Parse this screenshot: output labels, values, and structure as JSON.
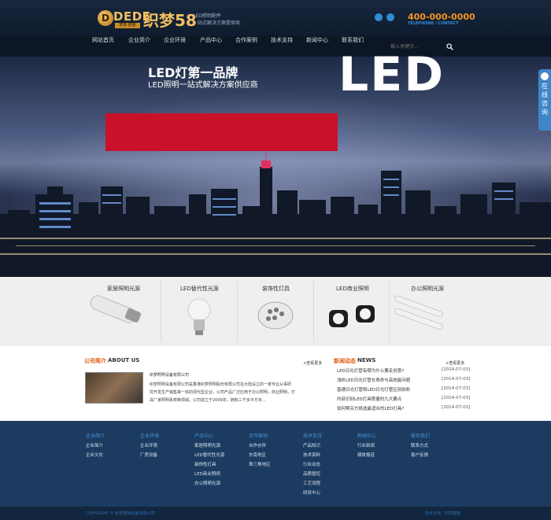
{
  "header": {
    "logo_mark": "D",
    "logo_brand": "DEDE",
    "logo_brand_sub": "梦想·技能",
    "logo_name": "织梦58",
    "slogan_line1": "LED照明配件",
    "slogan_line2": "一站式解决方案提供商",
    "phone": "400-000-0000",
    "phone_sub": "TELEPHONE / CONTACT"
  },
  "nav": {
    "items": [
      "网站首页",
      "企业简介",
      "企业环境",
      "产品中心",
      "合作案例",
      "技术支持",
      "新闻中心",
      "联系我们"
    ],
    "search_placeholder": "输入关键字..."
  },
  "banner": {
    "band_title": "LED灯第一品牌",
    "band_sub": "LED照明一站式解决方案供应商",
    "big_text": "LED",
    "float_tab": "在线咨询"
  },
  "products": [
    {
      "label": "家居照明光源"
    },
    {
      "label": "LED替代性光源"
    },
    {
      "label": "装饰性灯具"
    },
    {
      "label": "LED商业照明"
    },
    {
      "label": "办公照明光源"
    }
  ],
  "about": {
    "title_cn": "公司简介",
    "title_en": "ABOUT US",
    "more": "+查看更多",
    "company": "织梦照明设备有限公司",
    "lines": [
      "织梦照明设备有限公司是香港织梦照明股份有限公司在大陆设立的一家专业从事研",
      "究开发生产销售等一体的现代型企业，公司产品广泛应用于办公照明，商业照明，灯",
      "具厂家照明系统等领域，公司成立于2009年，拥有三千多平方米..."
    ]
  },
  "news": {
    "title_cn": "新闻动态",
    "title_en": "NEWS",
    "more": "+查看更多",
    "items": [
      {
        "title": "LED日光灯管有哪为什么要走创意?",
        "date": "[2014-07-03]"
      },
      {
        "title": "浅析LED日光灯管长寿命与高效能问题",
        "date": "[2014-07-03]"
      },
      {
        "title": "普通日光灯管和LED日光灯管区别剖析",
        "date": "[2014-07-03]"
      },
      {
        "title": "内部识别LED灯具质量的九大要点",
        "date": "[2014-07-03]"
      },
      {
        "title": "如何帮买方挑选最适合的LED灯具?",
        "date": "[2014-07-03]"
      }
    ]
  },
  "footer": {
    "columns": [
      {
        "head": "企业简介",
        "links": [
          "企业简介",
          "企业文化"
        ]
      },
      {
        "head": "企业环境",
        "links": [
          "企业环境",
          "厂房设备"
        ]
      },
      {
        "head": "产品中心",
        "links": [
          "家居照明光源",
          "LED替代性光源",
          "装饰性灯具",
          "LED商业照明",
          "办公照明光源"
        ]
      },
      {
        "head": "合作案例",
        "links": [
          "合作伙伴",
          "东南地区",
          "珠三角地区"
        ]
      },
      {
        "head": "技术支持",
        "links": [
          "产品知识",
          "技术资料",
          "行业动态",
          "品质管控",
          "工艺流程",
          "研发中心"
        ]
      },
      {
        "head": "新闻中心",
        "links": [
          "行业新闻",
          "媒体报道"
        ]
      },
      {
        "head": "联系我们",
        "links": [
          "联系方式",
          "客户反馈"
        ]
      }
    ],
    "copyright": "COPYRIGHT © 织梦照明设备有限公司",
    "right": "技术支持：织梦模板"
  },
  "colors": {
    "accent_red": "#c9112a",
    "phone_orange": "#f39322",
    "footer_blue": "#1c3b60",
    "title_orange": "#e05a10"
  }
}
